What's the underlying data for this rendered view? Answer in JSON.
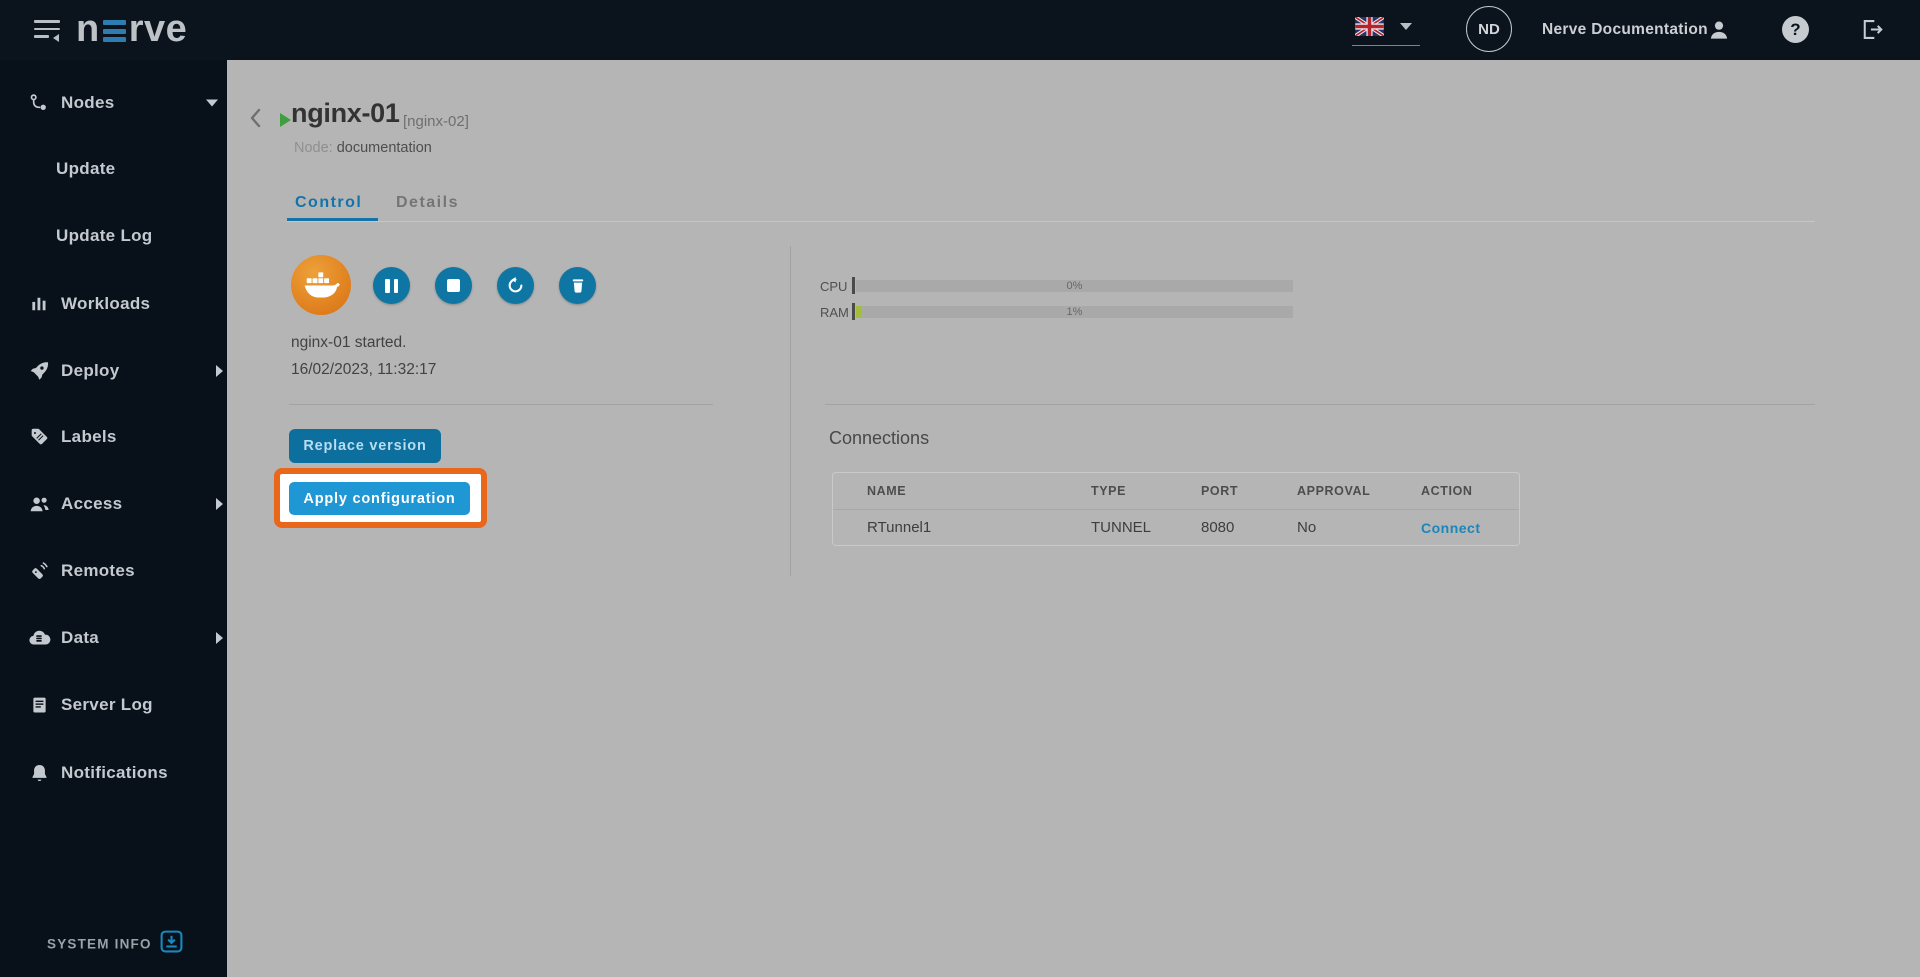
{
  "topbar": {
    "logo_text_pre": "n",
    "logo_text_post": "rve",
    "language": "en-GB",
    "avatar_initials": "ND",
    "account_name": "Nerve Documentation",
    "help_glyph": "?"
  },
  "sidebar": {
    "items": [
      {
        "label": "Nodes"
      },
      {
        "label": "Update"
      },
      {
        "label": "Update Log"
      },
      {
        "label": "Workloads"
      },
      {
        "label": "Deploy"
      },
      {
        "label": "Labels"
      },
      {
        "label": "Access"
      },
      {
        "label": "Remotes"
      },
      {
        "label": "Data"
      },
      {
        "label": "Server Log"
      },
      {
        "label": "Notifications"
      }
    ],
    "system_info_label": "SYSTEM INFO"
  },
  "header": {
    "title": "nginx-01",
    "version": "[nginx-02]",
    "node_label": "Node:",
    "node_value": "documentation"
  },
  "tabs": {
    "control": "Control",
    "details": "Details"
  },
  "control": {
    "status_message": "nginx-01 started.",
    "status_timestamp": "16/02/2023, 11:32:17",
    "replace_button": "Replace version",
    "apply_button": "Apply configuration"
  },
  "stats": {
    "cpu_label": "CPU",
    "cpu_value": "0%",
    "ram_label": "RAM",
    "ram_value": "1%"
  },
  "connections": {
    "title": "Connections",
    "columns": [
      "NAME",
      "TYPE",
      "PORT",
      "APPROVAL",
      "ACTION"
    ],
    "rows": [
      {
        "name": "RTunnel1",
        "type": "TUNNEL",
        "port": "8080",
        "approval": "No",
        "action": "Connect"
      }
    ]
  },
  "colors": {
    "accent_blue": "#1274a8",
    "button_blue": "#0d6f9e",
    "apply_blue": "#1e97d4",
    "highlight_orange": "#e8671b",
    "docker_orange": "#d96f10",
    "ram_green": "#a2bd3a",
    "play_green": "#3f9e3f"
  }
}
